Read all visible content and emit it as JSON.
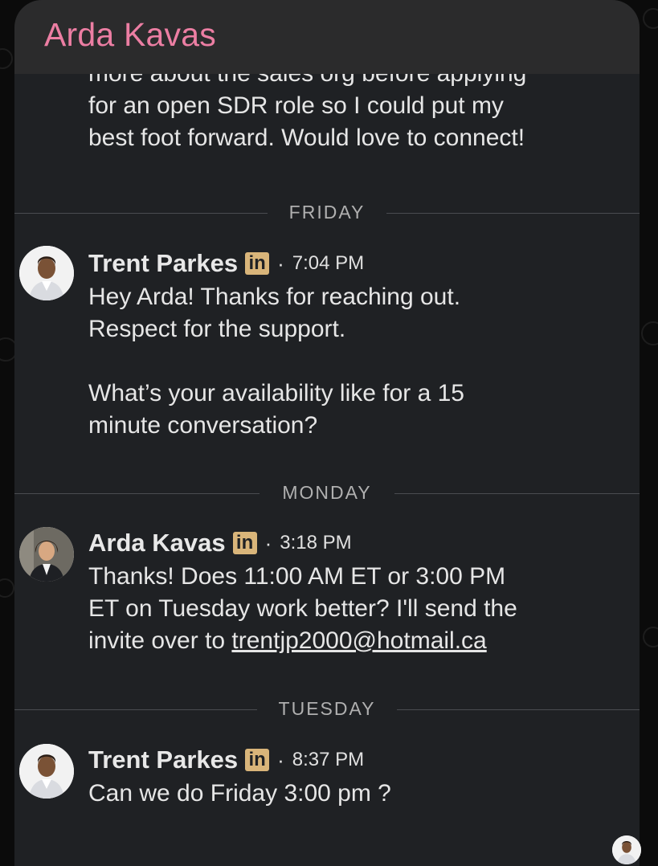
{
  "header": {
    "title": "Arda Kavas"
  },
  "thread": {
    "cut_message": "more about the sales org before applying\nfor an open SDR role so I could put my\nbest foot forward. Would love to connect!",
    "dividers": [
      "FRIDAY",
      "MONDAY",
      "TUESDAY"
    ],
    "messages": [
      {
        "sender": "Trent Parkes",
        "badge": "in",
        "separator": "·",
        "time": "7:04 PM",
        "text": "Hey Arda! Thanks for reaching out.\nRespect for the support.\n\nWhat’s your availability like for a 15\nminute conversation?"
      },
      {
        "sender": "Arda Kavas",
        "badge": "in",
        "separator": "·",
        "time": "3:18 PM",
        "text": "Thanks! Does 11:00 AM ET or 3:00 PM\nET on Tuesday work better? I'll send the\ninvite over to ",
        "link": "trentjp2000@hotmail.ca"
      },
      {
        "sender": "Trent Parkes",
        "badge": "in",
        "separator": "·",
        "time": "8:37 PM",
        "text": "Can we do Friday 3:00 pm ?"
      }
    ]
  },
  "colors": {
    "title": "#ec7ea3",
    "linkedin_badge": "#d9b57a",
    "card": "#1f2124",
    "header": "#2b2b2c"
  }
}
